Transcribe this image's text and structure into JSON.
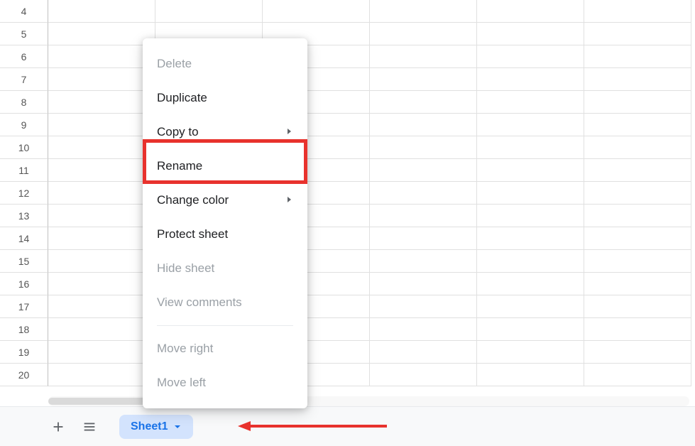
{
  "rows": [
    "4",
    "5",
    "6",
    "7",
    "8",
    "9",
    "10",
    "11",
    "12",
    "13",
    "14",
    "15",
    "16",
    "17",
    "18",
    "19",
    "20"
  ],
  "contextMenu": {
    "items": [
      {
        "label": "Delete",
        "disabled": true,
        "submenu": false
      },
      {
        "label": "Duplicate",
        "disabled": false,
        "submenu": false
      },
      {
        "label": "Copy to",
        "disabled": false,
        "submenu": true
      },
      {
        "label": "Rename",
        "disabled": false,
        "submenu": false
      },
      {
        "label": "Change color",
        "disabled": false,
        "submenu": true
      },
      {
        "label": "Protect sheet",
        "disabled": false,
        "submenu": false
      },
      {
        "label": "Hide sheet",
        "disabled": true,
        "submenu": false
      },
      {
        "label": "View comments",
        "disabled": true,
        "submenu": false
      },
      {
        "label": "Move right",
        "disabled": true,
        "submenu": false
      },
      {
        "label": "Move left",
        "disabled": true,
        "submenu": false
      }
    ]
  },
  "sheetBar": {
    "activeTab": "Sheet1"
  },
  "annotations": {
    "highlightedItem": "Rename",
    "arrowTarget": "sheet-tab"
  }
}
